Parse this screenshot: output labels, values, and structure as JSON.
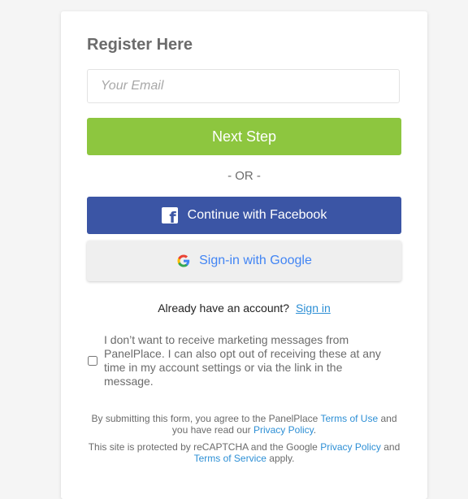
{
  "form": {
    "title": "Register Here",
    "email_placeholder": "Your Email",
    "next_label": "Next Step",
    "or_label": "- OR -",
    "facebook_label": "Continue with Facebook",
    "google_label": "Sign-in with Google",
    "account_question": "Already have an account?",
    "signin_link": "Sign in",
    "marketing_optout": "I don’t want to receive marketing messages from PanelPlace. I can also opt out of receiving these at any time in my account settings or via the link in the message.",
    "legal": {
      "submit_prefix": "By submitting this form, you agree to the PanelPlace",
      "terms_of_use": "Terms of Use",
      "and_read": "and you have read our",
      "privacy_policy": "Privacy Policy",
      "period": ".",
      "recaptcha_prefix": "This site is protected by reCAPTCHA and the Google",
      "google_privacy": "Privacy Policy",
      "and": "and",
      "terms_of_service": "Terms of Service",
      "apply": "apply."
    }
  },
  "colors": {
    "next_green": "#8dc63f",
    "facebook_blue": "#3b55a5",
    "google_blue": "#4285f4",
    "link_blue": "#2d8fd5"
  },
  "icons": {
    "facebook": "facebook-icon",
    "google": "google-icon"
  }
}
